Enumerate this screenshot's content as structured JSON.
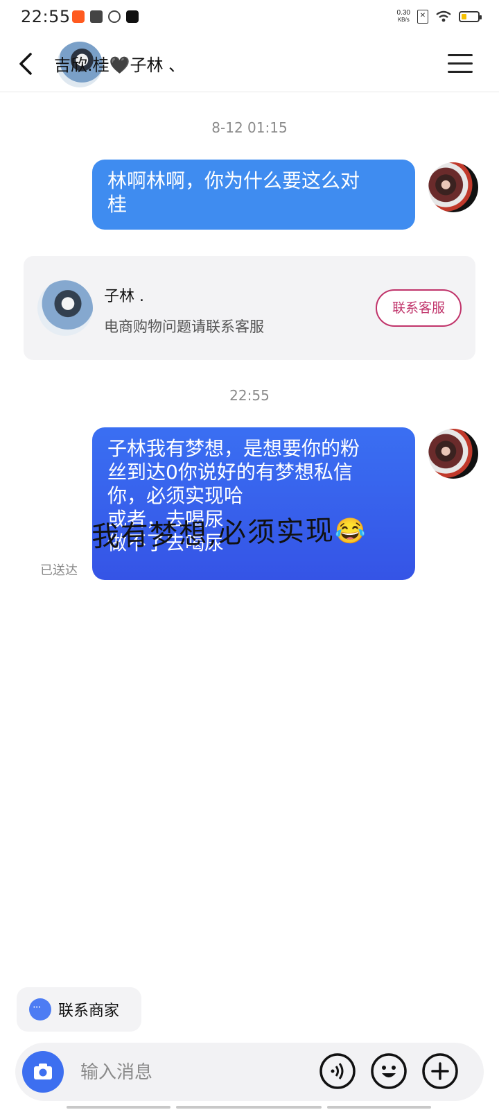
{
  "status_bar": {
    "time": "22:55",
    "net_speed_value": "0.30",
    "net_speed_unit": "KB/s",
    "battery_level": 0.3,
    "app_icons": [
      "taobao-icon",
      "video-icon",
      "link-icon",
      "tiktok-icon"
    ]
  },
  "header": {
    "title": "吉欣.桂🖤子林 、"
  },
  "messages": [
    {
      "timestamp": "8-12 01:15",
      "text_lines": [
        "林啊林啊，你为什么要这么对",
        "桂"
      ]
    },
    {
      "timestamp": "22:55",
      "text_lines": [
        "子林我有梦想，是想要你的粉",
        "丝到达0你说好的有梦想私信",
        "你，必须实现哈",
        "或者，去喝尿",
        "做不了去喝尿"
      ],
      "status": "已送达"
    }
  ],
  "contact_card": {
    "name": "子林 .",
    "description": "电商购物问题请联系客服",
    "button_label": "联系客服"
  },
  "handwriting_overlay": {
    "text": "我有梦想,必须实现",
    "emoji": "😂"
  },
  "merchant_chip": {
    "label": "联系商家"
  },
  "input_bar": {
    "placeholder": "输入消息"
  },
  "colors": {
    "bubble_blue": "#3f8cf0",
    "bubble_blue_dark": "#3554e6",
    "card_button_accent": "#c0336a",
    "camera_button": "#3d6ff0"
  }
}
